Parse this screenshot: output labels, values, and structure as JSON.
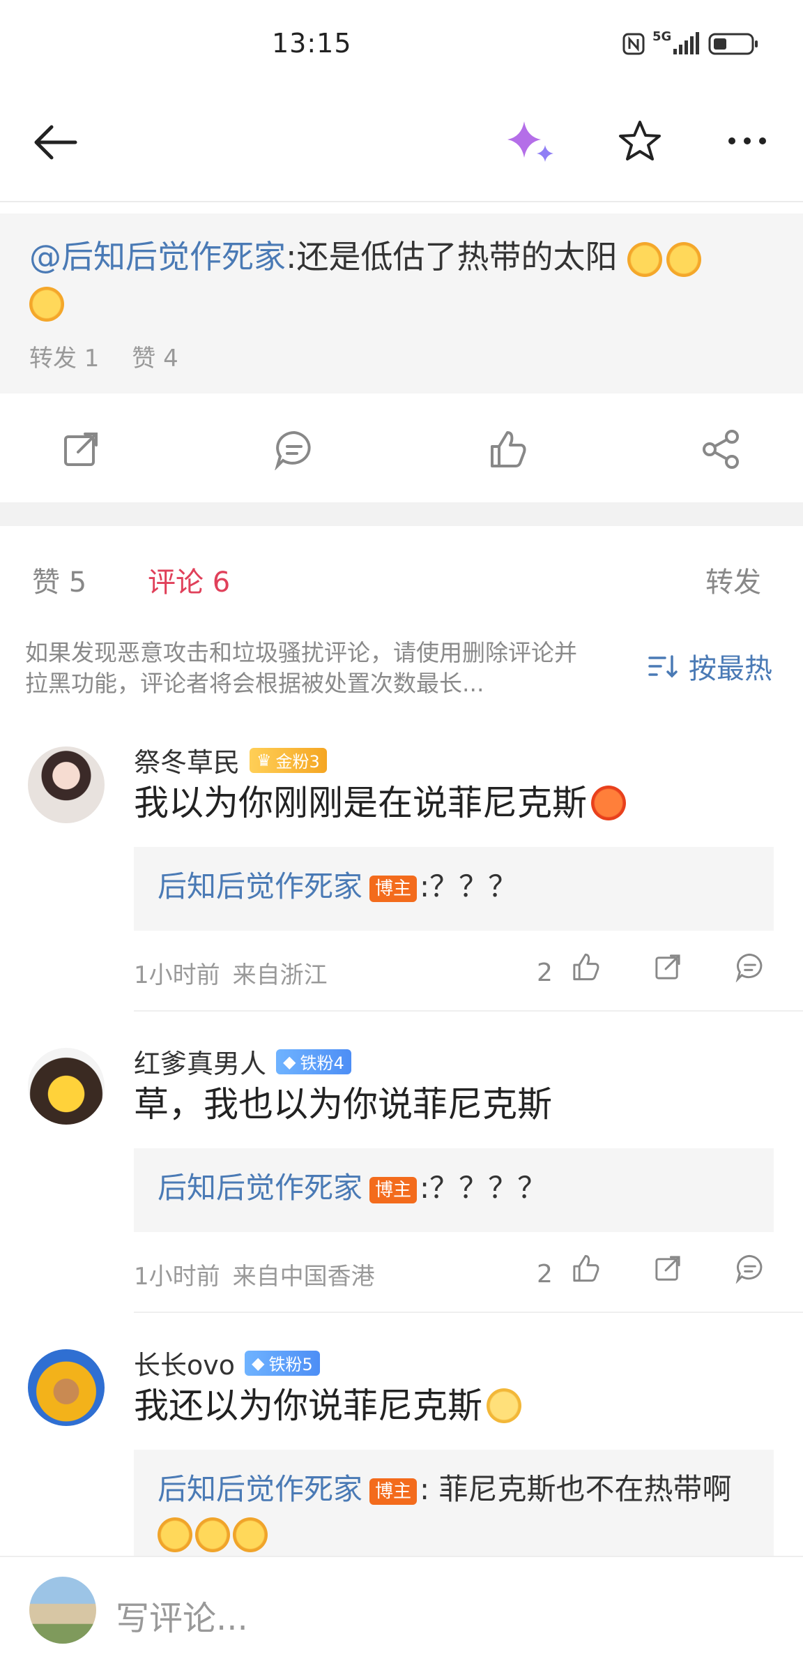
{
  "status_bar": {
    "time": "13:15",
    "network": "5G"
  },
  "quoted_post": {
    "mention": "@后知后觉作死家",
    "text": ":还是低估了热带的太阳",
    "reposts": "转发 1",
    "likes": "赞 4"
  },
  "tabs": {
    "likes": "赞 5",
    "comments": "评论 6",
    "reposts": "转发"
  },
  "notice": {
    "text": "如果发现恶意攻击和垃圾骚扰评论，请使用删除评论并拉黑功能，评论者将会根据被处置次数最长...",
    "sort_label": "按最热"
  },
  "comments": [
    {
      "name": "祭冬草民",
      "badge": "金粉3",
      "body": "我以为你刚刚是在说菲尼克斯",
      "reply_author": "后知后觉作死家",
      "host_label": "博主",
      "reply_text": ":？？？",
      "time": "1小时前",
      "location": "来自浙江",
      "like_count": "2"
    },
    {
      "name": "红爹真男人",
      "badge": "铁粉4",
      "body": "草，我也以为你说菲尼克斯",
      "reply_author": "后知后觉作死家",
      "host_label": "博主",
      "reply_text": ":？？？？",
      "time": "1小时前",
      "location": "来自中国香港",
      "like_count": "2"
    },
    {
      "name": "长长ovo",
      "badge": "铁粉5",
      "body": "我还以为你说菲尼克斯",
      "reply_author": "后知后觉作死家",
      "host_label": "博主",
      "reply_text": ": 菲尼克斯也不在热带啊"
    }
  ],
  "bottom_bar": {
    "placeholder": "写评论..."
  }
}
